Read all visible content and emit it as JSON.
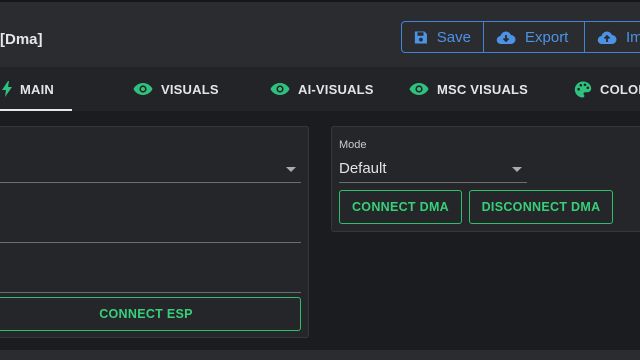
{
  "header": {
    "title": "[Dma]",
    "buttons": {
      "save": "Save",
      "export": "Export",
      "import": "Im"
    }
  },
  "tabs": [
    {
      "label": "MAIN",
      "icon": "bolt-icon",
      "active": true
    },
    {
      "label": "VISUALS",
      "icon": "eye-icon"
    },
    {
      "label": "AI-VISUALS",
      "icon": "eye-icon"
    },
    {
      "label": "MSC VISUALS",
      "icon": "eye-icon"
    },
    {
      "label": "COLOR",
      "icon": "palette-icon"
    }
  ],
  "esp_panel": {
    "connect_label": "CONNECT ESP"
  },
  "dma_panel": {
    "mode_label": "Mode",
    "mode_value": "Default",
    "connect_label": "CONNECT DMA",
    "disconnect_label": "DISCONNECT DMA"
  },
  "colors": {
    "accent_blue": "#3f84d6",
    "accent_green": "#37d07a",
    "tab_icon_green": "#2ec27e"
  }
}
